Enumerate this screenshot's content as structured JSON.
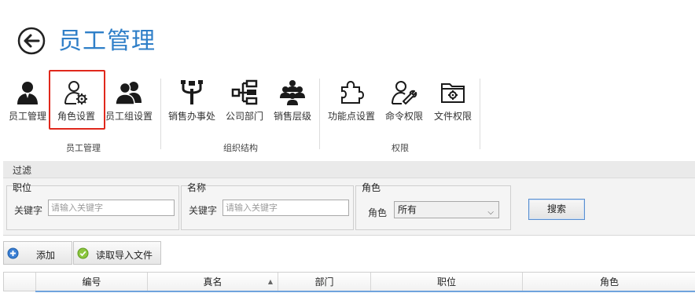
{
  "header": {
    "title": "员工管理",
    "back_icon": "back-arrow-icon"
  },
  "ribbon": {
    "groups": [
      {
        "label": "员工管理",
        "items": [
          {
            "label": "员工管理",
            "icon": "user-icon"
          },
          {
            "label": "角色设置",
            "icon": "user-gear-icon",
            "highlighted": true
          },
          {
            "label": "员工组设置",
            "icon": "users-group-icon"
          }
        ]
      },
      {
        "label": "组织结构",
        "items": [
          {
            "label": "销售办事处",
            "icon": "branch-icon"
          },
          {
            "label": "公司部门",
            "icon": "org-chart-icon"
          },
          {
            "label": "销售层级",
            "icon": "people-hierarchy-icon"
          }
        ]
      },
      {
        "label": "权限",
        "items": [
          {
            "label": "功能点设置",
            "icon": "puzzle-icon"
          },
          {
            "label": "命令权限",
            "icon": "user-wrench-icon"
          },
          {
            "label": "文件权限",
            "icon": "folder-gear-icon"
          }
        ]
      }
    ],
    "highlight_color": "#e0281c"
  },
  "filter": {
    "title": "过滤",
    "position": {
      "title": "职位",
      "keyword_label": "关键字",
      "placeholder": "请输入关键字"
    },
    "name": {
      "title": "名称",
      "keyword_label": "关键字",
      "placeholder": "请输入关键字"
    },
    "role": {
      "title": "角色",
      "label": "角色",
      "selected": "所有"
    },
    "search_label": "搜索"
  },
  "actions": {
    "add_label": "添加",
    "import_label": "读取导入文件"
  },
  "grid": {
    "columns": [
      "编号",
      "真名",
      "部门",
      "职位",
      "角色"
    ],
    "sorted_column": "真名"
  },
  "colors": {
    "accent": "#2f7fc8",
    "highlight": "#e0281c"
  }
}
